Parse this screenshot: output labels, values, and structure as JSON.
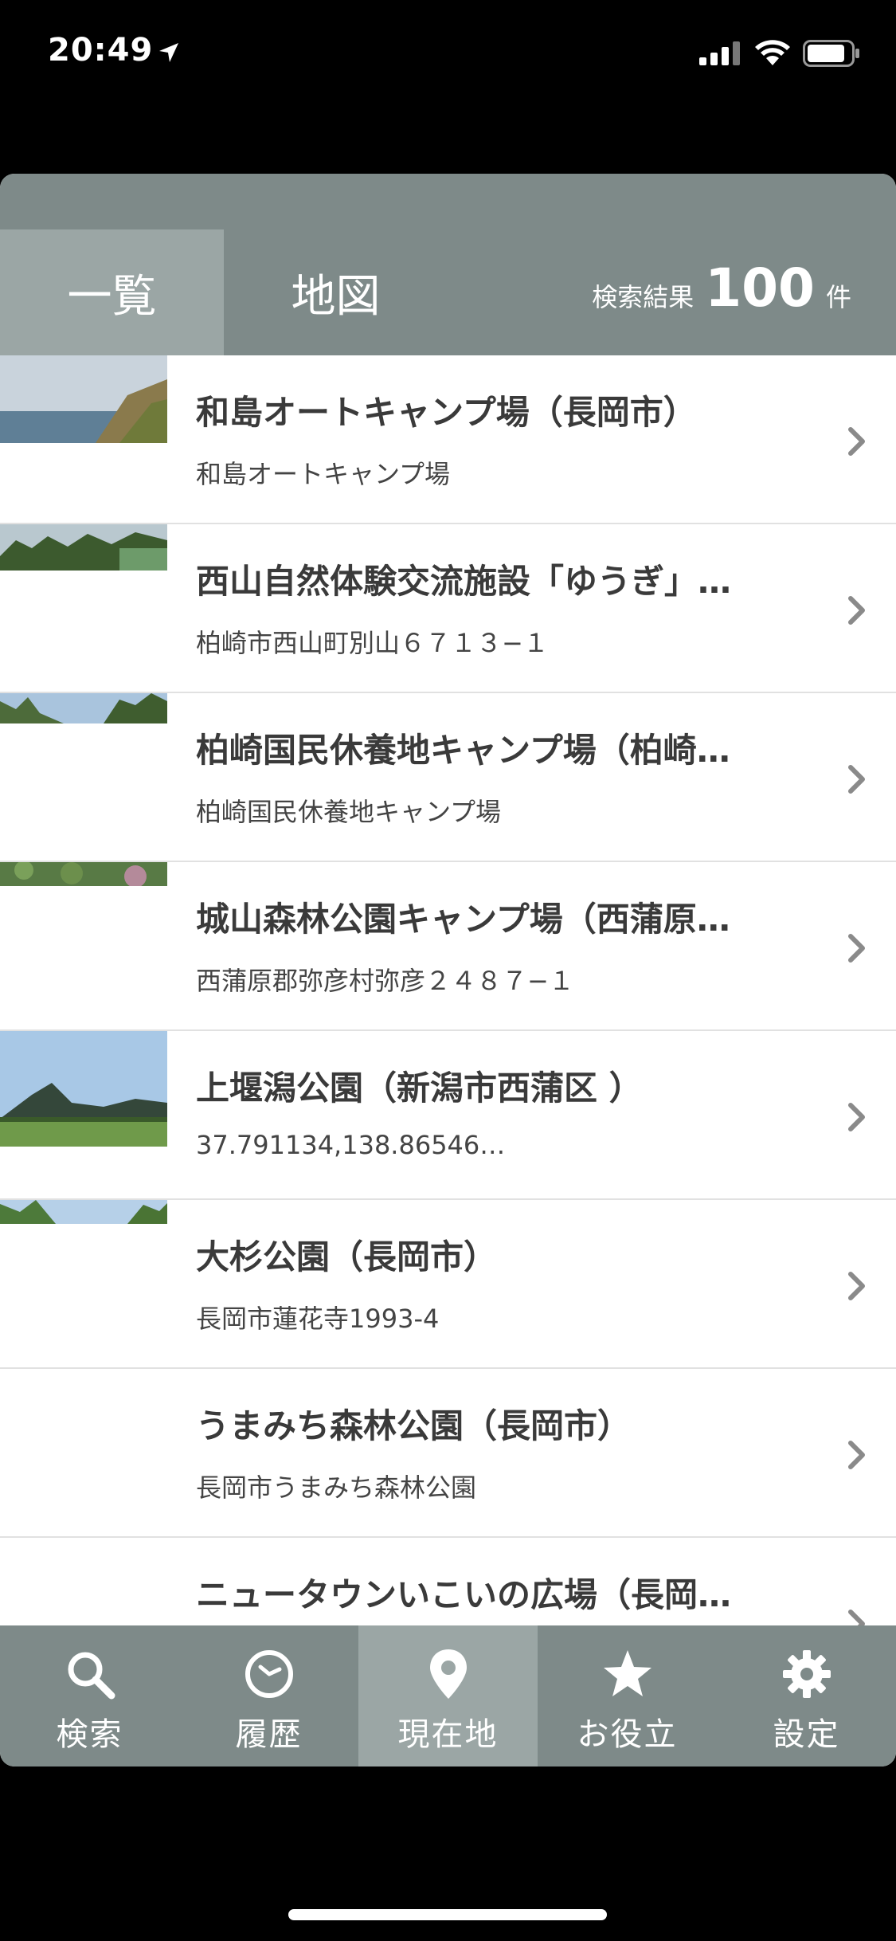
{
  "status": {
    "time": "20:49"
  },
  "tabs": {
    "list_label": "一覧",
    "map_label": "地図"
  },
  "result": {
    "label": "検索結果",
    "count": "100",
    "unit": "件"
  },
  "items": [
    {
      "title": "和島オートキャンプ場（長岡市）",
      "subtitle": "和島オートキャンプ場",
      "thumb": "sea-cliff"
    },
    {
      "title": "西山自然体験交流施設「ゆうぎ」…",
      "subtitle": "柏崎市西山町別山６７１３−１",
      "thumb": "forest-fence"
    },
    {
      "title": "柏崎国民休養地キャンプ場（柏崎…",
      "subtitle": "柏崎国民休養地キャンプ場",
      "thumb": "trees-sky"
    },
    {
      "title": "城山森林公園キャンプ場（西蒲原…",
      "subtitle": "西蒲原郡弥彦村弥彦２４８７−１",
      "thumb": "shrubs"
    },
    {
      "title": "上堰潟公園（新潟市西蒲区 ）",
      "subtitle": "37.791134,138.86546…",
      "thumb": "mountain-field"
    },
    {
      "title": "大杉公園（長岡市）",
      "subtitle": "長岡市蓮花寺1993-4",
      "thumb": "tree-sky"
    },
    {
      "title": "うまみち森林公園（長岡市）",
      "subtitle": "長岡市うまみち森林公園",
      "thumb": "none"
    },
    {
      "title": "ニュータウンいこいの広場（長岡…",
      "subtitle": "",
      "thumb": "none"
    }
  ],
  "tabbar": [
    {
      "label": "検索",
      "icon": "search-icon"
    },
    {
      "label": "履歴",
      "icon": "clock-icon"
    },
    {
      "label": "現在地",
      "icon": "location-pin-icon",
      "active": true
    },
    {
      "label": "お役立",
      "icon": "star-icon"
    },
    {
      "label": "設定",
      "icon": "gear-icon"
    }
  ],
  "colors": {
    "header": "#7e8a89",
    "active_tab": "#9ba6a5",
    "background": "#000000"
  }
}
